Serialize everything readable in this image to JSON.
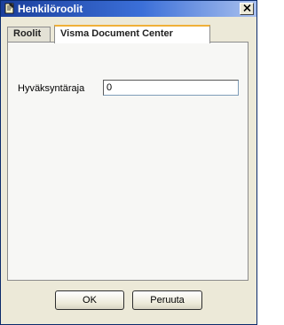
{
  "window": {
    "title": "Henkilöroolit",
    "close_glyph": "✕"
  },
  "tabs": [
    {
      "label": "Roolit",
      "selected": false
    },
    {
      "label": "Visma Document Center",
      "selected": true
    }
  ],
  "form": {
    "approval_limit_label": "Hyväksyntäraja",
    "approval_limit_value": "0"
  },
  "buttons": {
    "ok_label": "OK",
    "cancel_label": "Peruuta"
  },
  "icons": {
    "title_icon": "notepad-icon",
    "close_icon": "close-icon"
  },
  "colors": {
    "titlebar_dark": "#1b3f9c",
    "titlebar_light": "#a9c0ee",
    "dialog_bg": "#ece9d8",
    "active_tab_accent": "#f0b038"
  }
}
